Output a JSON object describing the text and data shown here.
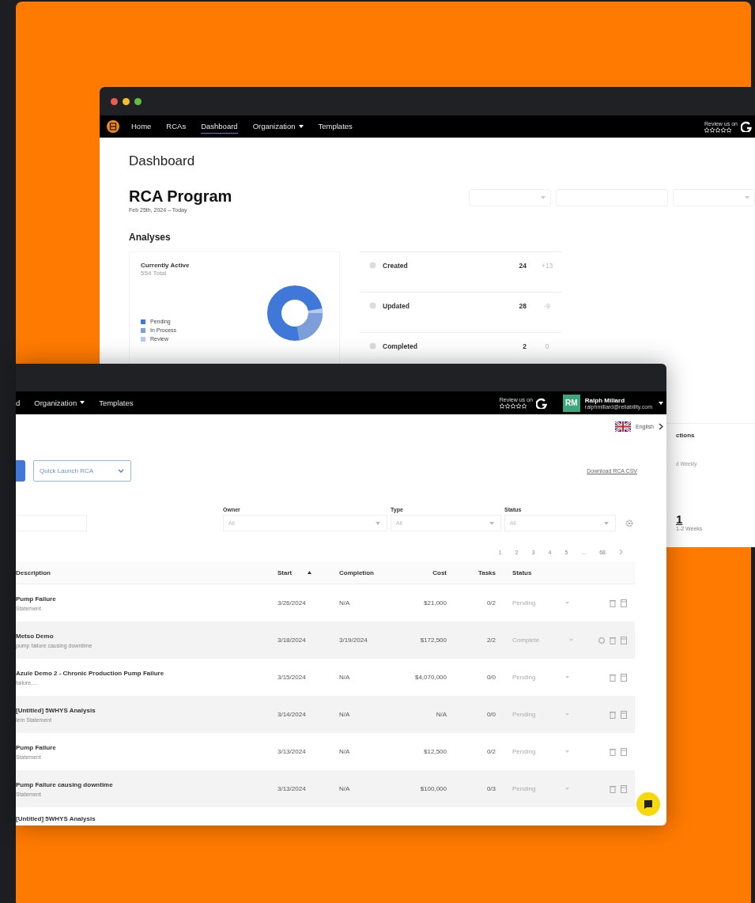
{
  "back_window": {
    "title_bar": {
      "buttons": [
        {
          "color": "#ee5b52"
        },
        {
          "color": "#f2bd2c"
        },
        {
          "color": "#5ec043"
        }
      ]
    },
    "nav": [
      {
        "label": "Home",
        "selected": false,
        "has_menu": false
      },
      {
        "label": "RCAs",
        "selected": false,
        "has_menu": false
      },
      {
        "label": "Dashboard",
        "selected": true,
        "has_menu": false
      },
      {
        "label": "Organization",
        "selected": false,
        "has_menu": true
      },
      {
        "label": "Templates",
        "selected": false,
        "has_menu": false
      }
    ],
    "review": "Review us on",
    "page_title": "Dashboard",
    "program": {
      "title": "RCA Program",
      "date_range": "Feb 25th, 2024 – Today"
    },
    "filters": [
      {
        "kind": "select"
      },
      {
        "kind": "text"
      },
      {
        "kind": "select"
      }
    ],
    "section": "Analyses",
    "active_card": {
      "title": "Currently Active",
      "total": "554 Total",
      "legend": [
        {
          "label": "Pending",
          "color": "#3f78d8"
        },
        {
          "label": "In Process",
          "color": "#7d9fd9"
        },
        {
          "label": "Review",
          "color": "#b7c9ea"
        }
      ]
    },
    "stats": [
      {
        "label": "Created",
        "value": "24",
        "change": "+13"
      },
      {
        "label": "Updated",
        "value": "28",
        "change": "-9"
      },
      {
        "label": "Completed",
        "value": "2",
        "change": "0"
      }
    ],
    "side_panel": {
      "heading": "ctions",
      "frequency": "d Weekly",
      "count": "1",
      "count_label": "1-2 Weeks"
    }
  },
  "front_window": {
    "nav": [
      {
        "label": "d",
        "selected": false,
        "has_menu": false
      },
      {
        "label": "Organization",
        "selected": false,
        "has_menu": true
      },
      {
        "label": "Templates",
        "selected": false,
        "has_menu": false
      }
    ],
    "review": "Review us on",
    "user": {
      "initials": "RM",
      "name": "Ralph Millard",
      "email": "ralphmillard@reliability.com"
    },
    "language": "English",
    "quick_launch": "Quick Launch RCA",
    "download": "Download RCA CSV",
    "filters": [
      {
        "label": "Owner",
        "value": "All"
      },
      {
        "label": "Type",
        "value": "All"
      },
      {
        "label": "Status",
        "value": "All"
      }
    ],
    "pages": [
      "1",
      "2",
      "3",
      "4",
      "5",
      "...",
      "68"
    ],
    "columns": [
      {
        "label": "Description",
        "sorted": false
      },
      {
        "label": "Start",
        "sorted": true
      },
      {
        "label": "Completion",
        "sorted": false
      },
      {
        "label": "Cost",
        "sorted": false
      },
      {
        "label": "Tasks",
        "sorted": false
      },
      {
        "label": "Status",
        "sorted": false
      }
    ],
    "rows": [
      {
        "title": "Pump Failure",
        "subtitle": "Statement",
        "start": "3/26/2024",
        "completion": "N/A",
        "cost": "$21,000",
        "tasks": "0/2",
        "status": "Pending",
        "circle_icon": false
      },
      {
        "title": "Metso Demo",
        "subtitle": "pump failure causing downtime",
        "start": "3/18/2024",
        "completion": "3/19/2024",
        "cost": "$172,500",
        "tasks": "2/2",
        "status": "Complete",
        "circle_icon": true
      },
      {
        "title": "Azule Demo 2 - Chronic Production Pump Failure",
        "subtitle": "failure....",
        "start": "3/15/2024",
        "completion": "N/A",
        "cost": "$4,070,000",
        "tasks": "0/0",
        "status": "Pending",
        "circle_icon": false
      },
      {
        "title": "[Untitled] 5WHYS Analysis",
        "subtitle": "lem Statement",
        "start": "3/14/2024",
        "completion": "N/A",
        "cost": "N/A",
        "tasks": "0/0",
        "status": "Pending",
        "circle_icon": false
      },
      {
        "title": "Pump Failure",
        "subtitle": "Statement",
        "start": "3/13/2024",
        "completion": "N/A",
        "cost": "$12,500",
        "tasks": "0/2",
        "status": "Pending",
        "circle_icon": false
      },
      {
        "title": "Pump Failure causing downtime",
        "subtitle": "Statement",
        "start": "3/13/2024",
        "completion": "N/A",
        "cost": "$100,000",
        "tasks": "0/3",
        "status": "Pending",
        "circle_icon": false
      },
      {
        "title": "[Untitled] 5WHYS Analysis"
      }
    ]
  }
}
